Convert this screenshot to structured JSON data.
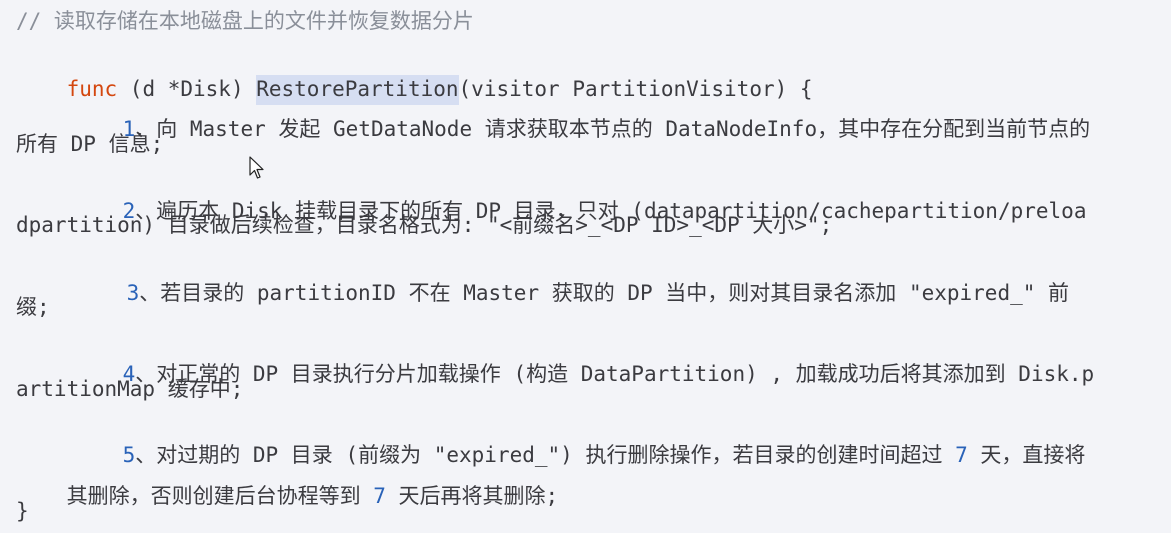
{
  "lines": {
    "l1": "// 读取存储在本地磁盘上的文件并恢复数据分片",
    "l2_kw": "func",
    "l2_a": " (d *Disk) ",
    "l2_fn": "RestorePartition",
    "l2_b": "(visitor PartitionVisitor) {",
    "l3_num": "1",
    "l3_rest": "、向 Master 发起 GetDataNode 请求获取本节点的 DataNodeInfo，其中存在分配到当前节点的",
    "l4": "所有 DP 信息;",
    "l5_num": "2",
    "l5_rest": "、遍历本 Disk 挂载目录下的所有 DP 目录，只对 (datapartition/cachepartition/preloa",
    "l6": "dpartition) 目录做后续检查，目录名格式为: \"<前缀名>_<DP ID>_<DP 大小>\";",
    "l7_num": "3",
    "l7_rest": "、若目录的 partitionID 不在 Master 获取的 DP 当中，则对其目录名添加 \"expired_\" 前",
    "l8": "缀;",
    "l9_num": "4",
    "l9_rest": "、对正常的 DP 目录执行分片加载操作 (构造 DataPartition) , 加载成功后将其添加到 Disk.p",
    "l10": "artitionMap 缓存中;",
    "l11_num": "5",
    "l11_a": "、对过期的 DP 目录 (前缀为 \"expired_\") 执行删除操作，若目录的创建时间超过 ",
    "l11_n": "7",
    "l11_b": " 天，直接将",
    "l12_a": "其删除，否则创建后台协程等到 ",
    "l12_n": "7",
    "l12_b": " 天后再将其删除;",
    "l13": "}"
  },
  "colors": {
    "background": "#f3f4f8",
    "comment": "#8a8f99",
    "keyword": "#d4470f",
    "number": "#2962b8",
    "highlight": "#d6def2"
  },
  "icons": {
    "cursor": "mouse-pointer-icon"
  }
}
